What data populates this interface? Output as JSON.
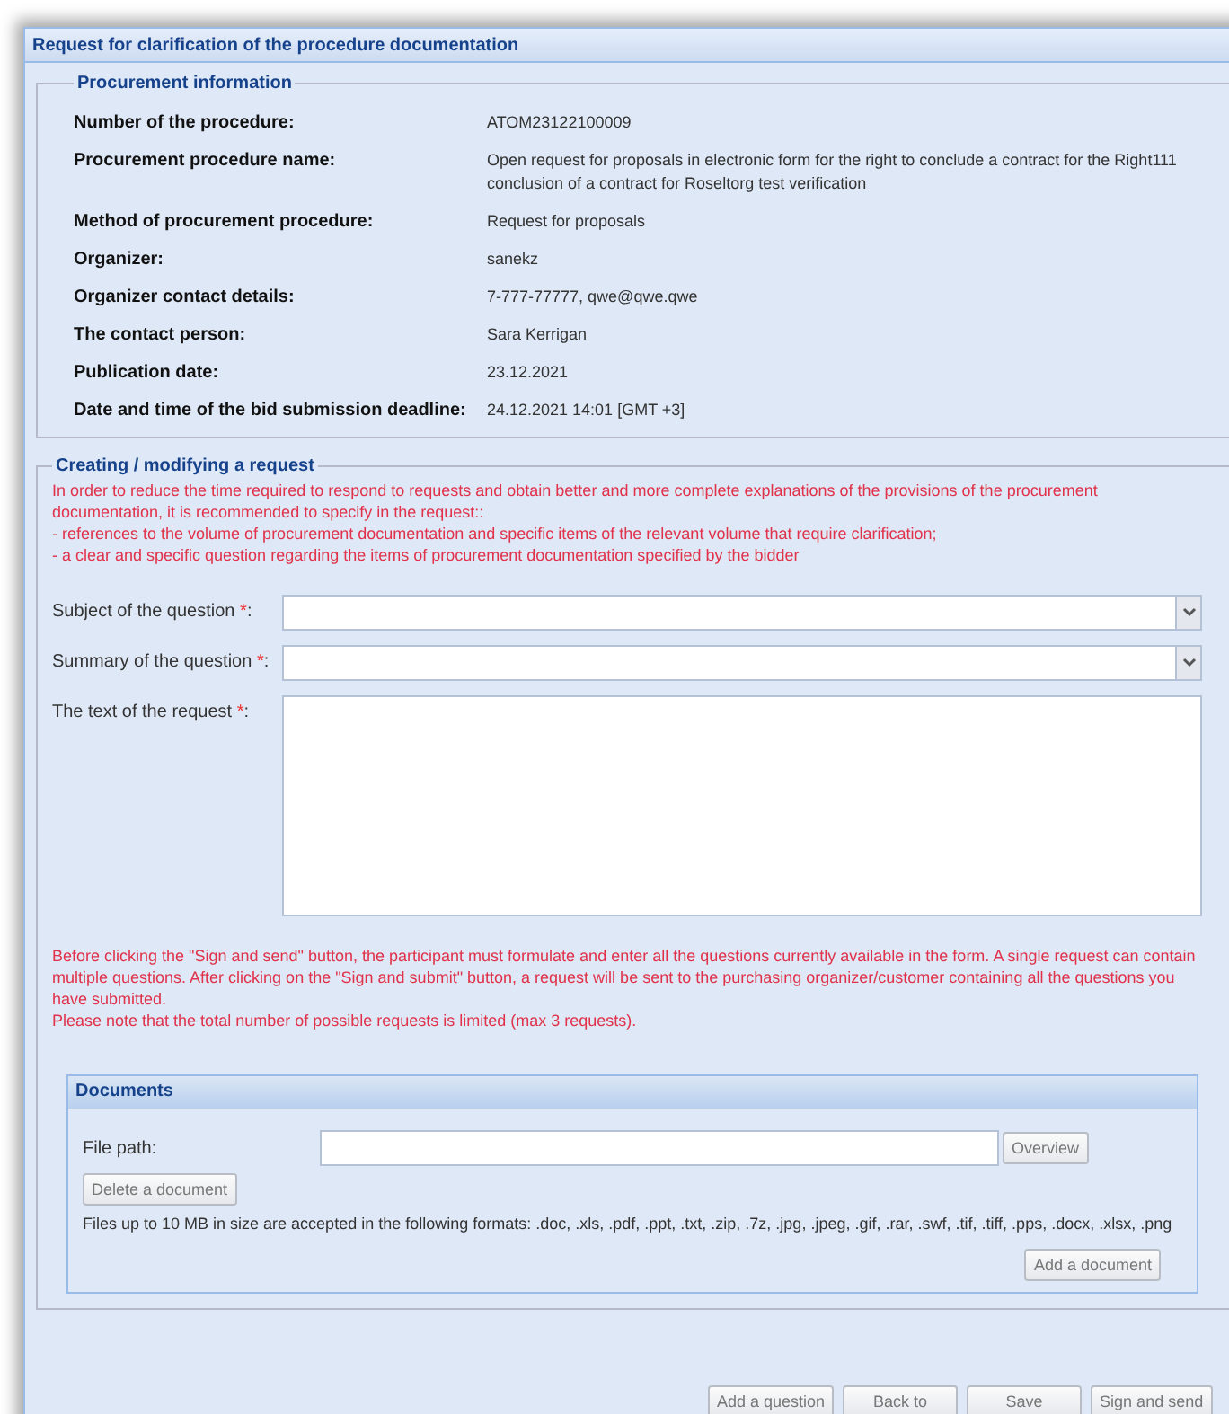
{
  "window": {
    "title": "Request for clarification of the procedure documentation"
  },
  "procurement": {
    "legend": "Procurement information",
    "rows": [
      {
        "label": "Number of the procedure:",
        "value": "ATOM23122100009"
      },
      {
        "label": "Procurement procedure name:",
        "value": "Open request for proposals in electronic form for the right to conclude a contract for the Right111 conclusion of a contract for Roseltorg test verification"
      },
      {
        "label": "Method of procurement procedure:",
        "value": "Request for proposals"
      },
      {
        "label": "Organizer:",
        "value": "sanekz"
      },
      {
        "label": "Organizer contact details:",
        "value": "7-777-77777, qwe@qwe.qwe"
      },
      {
        "label": "The contact person:",
        "value": "Sara Kerrigan"
      },
      {
        "label": "Publication date:",
        "value": "23.12.2021"
      },
      {
        "label": "Date and time of the bid submission deadline:",
        "value": "24.12.2021 14:01 [GMT +3]"
      }
    ]
  },
  "request": {
    "legend": "Creating / modifying a request",
    "notice": [
      "In order to reduce the time required to respond to requests and obtain better and more complete explanations of the provisions of the procurement documentation, it is recommended to specify in the request::",
      "- references to the volume of procurement documentation and specific items of the relevant volume that require clarification;",
      "- a clear and specific question regarding the items of procurement documentation specified by the bidder"
    ],
    "fields": [
      {
        "kind": "select",
        "label": "Subject of the question ",
        "mark": "*",
        "suffix": ":"
      },
      {
        "kind": "select",
        "label": "Summary of the question ",
        "mark": "*",
        "suffix": ":"
      },
      {
        "kind": "textarea",
        "label": "The text of the request ",
        "mark": "*",
        "suffix": ":"
      }
    ],
    "warning": [
      "Before clicking the \"Sign and send\" button, the participant must formulate and enter all the questions currently available in the form. A single request can contain multiple questions. After clicking on the \"Sign and submit\" button, a request will be sent to the purchasing organizer/customer containing all the questions you have submitted.",
      "Please note that the total number of possible requests is limited (max 3 requests)."
    ],
    "documents": {
      "title": "Documents",
      "file_label": "File path:",
      "browse": "Overview",
      "delete": "Delete a document",
      "hint": "Files up to 10 MB in size are accepted in the following formats: .doc, .xls, .pdf, .ppt, .txt, .zip, .7z, .jpg, .jpeg, .gif, .rar, .swf, .tif, .tiff, .pps, .docx, .xlsx, .png",
      "add": "Add a document"
    }
  },
  "buttons": [
    "Add a question",
    "Back to",
    "Save",
    "Sign and send"
  ]
}
